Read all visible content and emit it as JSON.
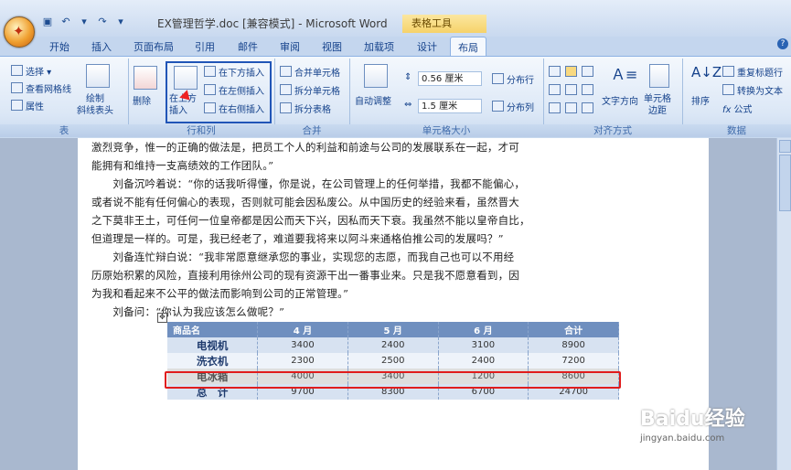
{
  "window": {
    "title": "EX管理哲学.doc [兼容模式] - Microsoft Word",
    "context_tab_group": "表格工具"
  },
  "tabs": [
    "开始",
    "插入",
    "页面布局",
    "引用",
    "邮件",
    "审阅",
    "视图",
    "加载项",
    "设计",
    "布局"
  ],
  "active_tab": "布局",
  "ribbon": {
    "table_group": {
      "label": "表",
      "select": "选择",
      "gridlines": "查看网格线",
      "properties": "属性",
      "draw_eraser": "绘制\n斜线表头"
    },
    "rows_cols_group": {
      "label": "行和列",
      "delete": "删除",
      "insert_above": "在上方\n插入",
      "insert_below": "在下方插入",
      "insert_left": "在左侧插入",
      "insert_right": "在右侧插入"
    },
    "merge_group": {
      "label": "合并",
      "merge_cells": "合并单元格",
      "split_cells": "拆分单元格",
      "split_table": "拆分表格"
    },
    "cell_size_group": {
      "label": "单元格大小",
      "autofit": "自动调整",
      "height_value": "0.56 厘米",
      "width_value": "1.5 厘米",
      "distribute_rows": "分布行",
      "distribute_cols": "分布列"
    },
    "alignment_group": {
      "label": "对齐方式",
      "text_direction": "文字方向",
      "cell_margins": "单元格\n边距"
    },
    "data_group": {
      "label": "数据",
      "sort": "排序",
      "repeat_header": "重复标题行",
      "convert_text": "转换为文本",
      "formula": "公式"
    }
  },
  "document": {
    "paragraphs": [
      "激烈竞争，惟一的正确的做法是，把员工个人的利益和前途与公司的发展联系在一起，才可",
      "能拥有和维持一支高绩效的工作团队。”",
      "　　刘备沉吟着说：“你的话我听得懂，你是说，在公司管理上的任何举措，我都不能偏心，",
      "或者说不能有任何偏心的表现，否则就可能会因私废公。从中国历史的经验来看，虽然晋大",
      "之下莫非王土，可任何一位皇帝都是因公而天下兴，因私而天下衰。我虽然不能以皇帝自比，",
      "但道理是一样的。可是，我已经老了，难道要我将来以阿斗来通格伯推公司的发展吗？”",
      "　　刘备连忙辩白说：“我非常愿意继承您的事业，实现您的志愿，而我自己也可以不用经",
      "历原始积累的风险，直接利用徐州公司的现有资源干出一番事业来。只是我不愿意看到，因",
      "为我和看起来不公平的做法而影响到公司的正常管理。”",
      "　　刘备问：“你认为我应该怎么做呢？”"
    ],
    "table": {
      "headers": [
        "商品名",
        "4 月",
        "5 月",
        "6 月",
        "合计"
      ],
      "rows": [
        [
          "电视机",
          "3400",
          "2400",
          "3100",
          "8900"
        ],
        [
          "洗衣机",
          "2300",
          "2500",
          "2400",
          "7200"
        ],
        [
          "电冰箱",
          "4000",
          "3400",
          "1200",
          "8600"
        ],
        [
          "总　计",
          "9700",
          "8300",
          "6700",
          "24700"
        ]
      ],
      "highlighted_row": "电冰箱"
    }
  },
  "watermark": {
    "brand": "Baidu经验",
    "url": "jingyan.baidu.com"
  },
  "colors": {
    "highlight_box": "#e01c1c",
    "table_header": "#6f8fbf"
  }
}
